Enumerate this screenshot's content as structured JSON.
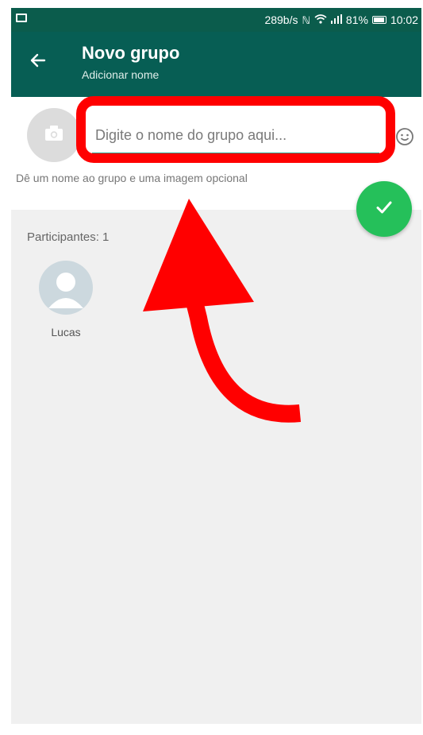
{
  "status_bar": {
    "speed": "289b/s",
    "signal_strength": "81%",
    "time": "10:02",
    "icons": [
      "image-icon",
      "mute-icon",
      "wifi-icon",
      "signal-icon",
      "battery-icon"
    ]
  },
  "app_bar": {
    "title": "Novo grupo",
    "subtitle": "Adicionar nome",
    "back_icon": "arrow-left-icon",
    "background_color": "#075e54"
  },
  "group_header": {
    "camera_icon": "camera-icon",
    "name_input": {
      "placeholder": "Digite o nome do grupo aqui...",
      "value": ""
    },
    "emoji_icon": "smiley-icon",
    "hint": "Dê um nome ao grupo e uma imagem opcional"
  },
  "fab": {
    "icon": "check-icon",
    "color": "#25c05a"
  },
  "participants": {
    "title": "Participantes: 1",
    "items": [
      {
        "name": "Lucas",
        "avatar_icon": "person-icon"
      }
    ]
  },
  "annotation": {
    "color": "#ff0000",
    "shapes": [
      "highlight-box",
      "curved-arrow"
    ]
  }
}
